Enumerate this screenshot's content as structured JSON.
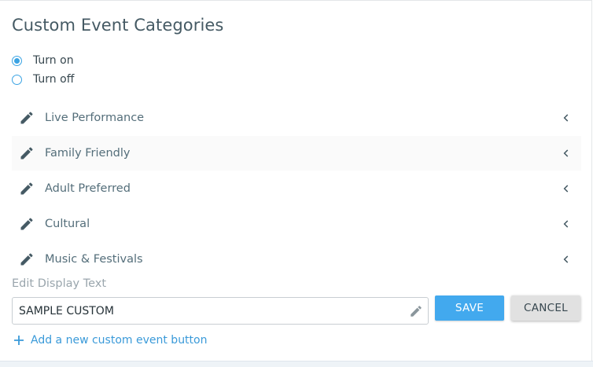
{
  "title": "Custom Event Categories",
  "toggle": {
    "options": [
      {
        "label": "Turn on",
        "selected": true
      },
      {
        "label": "Turn off",
        "selected": false
      }
    ]
  },
  "categories": [
    {
      "label": "Live Performance"
    },
    {
      "label": "Family Friendly"
    },
    {
      "label": "Adult Preferred"
    },
    {
      "label": "Cultural"
    },
    {
      "label": "Music & Festivals"
    }
  ],
  "editor": {
    "label": "Edit Display Text",
    "value": "SAMPLE CUSTOM"
  },
  "buttons": {
    "save": "SAVE",
    "cancel": "CANCEL"
  },
  "add_link": "Add a new custom event button",
  "colors": {
    "accent": "#42a9ee",
    "radio": "#3aa3e3",
    "link": "#3a9ad9",
    "icon": "#455a64"
  },
  "icons": {
    "row": "pencil-icon",
    "expand": "chevron-left-icon",
    "input_edit": "pencil-icon",
    "add": "plus-icon"
  }
}
